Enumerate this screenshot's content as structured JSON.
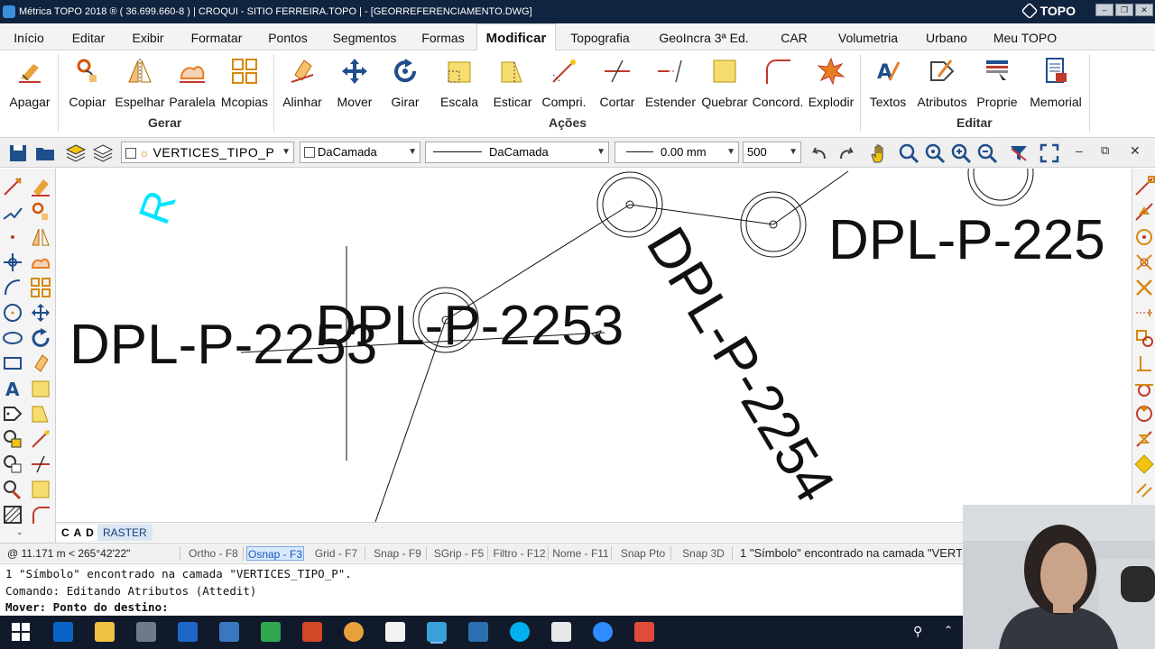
{
  "window": {
    "title": "Métrica TOPO 2018 ® ( 36.699.660-8 ) | CROQUI - SITIO FERREIRA.TOPO |  - [GEORREFERENCIAMENTO.DWG]",
    "brand": "TOPO",
    "controls": {
      "minimize": "–",
      "restore": "❐",
      "close": "✕"
    }
  },
  "menu": {
    "tabs": [
      "Início",
      "Editar",
      "Exibir",
      "Formatar",
      "Pontos",
      "Segmentos",
      "Formas",
      "Modificar",
      "Topografia",
      "GeoIncra 3ª Ed.",
      "CAR",
      "Volumetria",
      "Urbano",
      "Meu TOPO"
    ],
    "active": "Modificar"
  },
  "ribbon": {
    "groups": {
      "gerar": "Gerar",
      "acoes": "Ações",
      "editar": "Editar"
    },
    "buttons": [
      "Apagar",
      "Copiar",
      "Espelhar",
      "Paralela",
      "Mcopias",
      "Alinhar",
      "Mover",
      "Girar",
      "Escala",
      "Esticar",
      "Compri.",
      "Cortar",
      "Estender",
      "Quebrar",
      "Concord.",
      "Explodir",
      "Textos",
      "Atributos",
      "Proprie",
      "Memorial"
    ]
  },
  "toolbar": {
    "layer": "VERTICES_TIPO_P",
    "color": "DaCamada",
    "linetype": "DaCamada",
    "lineweight": "0.00 mm",
    "scale": "500"
  },
  "drawing": {
    "labels": [
      "DPL-P-2253",
      "DPL-P-2253",
      "DPL-P-2254",
      "DPL-P-225",
      "R"
    ]
  },
  "cad_tabs": [
    "C A D",
    "RASTER"
  ],
  "status": {
    "coords": "@ 11.171 m < 265°42'22\"",
    "toggles": [
      "Ortho - F8",
      "Osnap - F3",
      "Grid - F7",
      "Snap - F9",
      "SGrip - F5",
      "Filtro - F12",
      "Nome - F11",
      "Snap Pto",
      "Snap 3D"
    ],
    "active_toggle": "Osnap - F3",
    "message": "1 \"Símbolo\" encontrado na camada \"VERTICES_TIPO_P\"."
  },
  "command": {
    "lines": [
      "1 \"Símbolo\" encontrado na camada \"VERTICES_TIPO_P\".",
      "Comando: Editando Atributos (Attedit)",
      "Mover: Ponto do destino:"
    ]
  },
  "colors": {
    "titlebar": "#10233f",
    "accent_cyan": "#00e5ff",
    "taskbar": "#101a2b"
  }
}
